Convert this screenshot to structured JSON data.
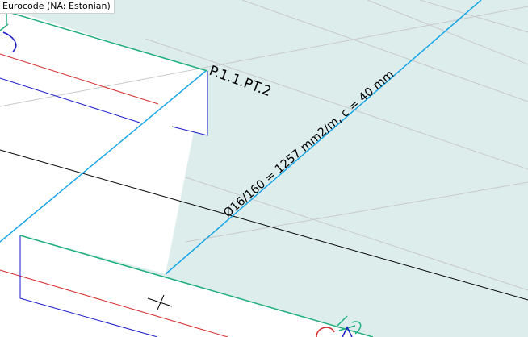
{
  "app": {
    "code_label": "Eurocode (NA: Estonian)"
  },
  "model": {
    "zone_label": "P.1.1.PT.2",
    "reinforcement_label": "Ø16/160 = 1257 mm2/m, c = 40 mm"
  },
  "colors": {
    "slab_fill": "#dcedec",
    "slab_edge": "#1fae7c",
    "zone_outline": "#1aa5e6",
    "bottom_reinforcement": "#1a1acb",
    "top_reinforcement": "#d42a2a",
    "grid_line": "#c9c9c9",
    "axis_line": "#000000"
  }
}
